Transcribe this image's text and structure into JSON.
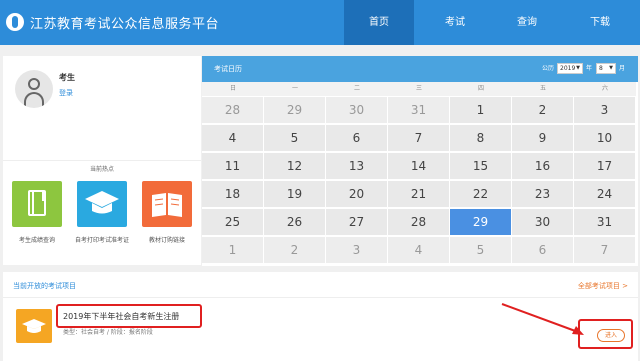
{
  "header": {
    "site_title": "江苏教育考试公众信息服务平台",
    "nav": [
      "首页",
      "考试",
      "查询",
      "下载"
    ],
    "active_nav": "首页"
  },
  "profile": {
    "user_name": "考生",
    "login_link": "登录"
  },
  "hot": {
    "title": "当前热点",
    "tiles": [
      {
        "label": "考生成绩查询",
        "color": "#8dc63f",
        "icon": "notebook-icon"
      },
      {
        "label": "自考打印考试准考证",
        "color": "#2aa9e0",
        "icon": "graduation-cap-icon"
      },
      {
        "label": "教材订购链接",
        "color": "#f26b3a",
        "icon": "open-book-icon"
      }
    ]
  },
  "calendar": {
    "title": "考试日历",
    "year_prefix": "公历",
    "year_value": "2019",
    "year_suffix": "年",
    "month_value": "8",
    "month_suffix": "月",
    "weekdays": [
      "日",
      "一",
      "二",
      "三",
      "四",
      "五",
      "六"
    ],
    "weeks": [
      [
        "28",
        "29",
        "30",
        "31",
        "1",
        "2",
        "3"
      ],
      [
        "4",
        "5",
        "6",
        "7",
        "8",
        "9",
        "10"
      ],
      [
        "11",
        "12",
        "13",
        "14",
        "15",
        "16",
        "17"
      ],
      [
        "18",
        "19",
        "20",
        "21",
        "22",
        "23",
        "24"
      ],
      [
        "25",
        "26",
        "27",
        "28",
        "29",
        "30",
        "31"
      ],
      [
        "1",
        "2",
        "3",
        "4",
        "5",
        "6",
        "7"
      ]
    ],
    "today": "29"
  },
  "projects": {
    "heading": "当前开放的考试项目",
    "all_link": "全部考试项目 >",
    "items": [
      {
        "name": "2019年下半年社会自考新生注册",
        "meta": "类型：社会自考 / 阶段：报名阶段",
        "action": "进入"
      }
    ]
  },
  "colors": {
    "header": "#2d8cd9",
    "active_nav": "#1d6fb8",
    "calendar_bar": "#4aa3df",
    "today": "#4a90e2",
    "highlight": "#e02020",
    "accent": "#e8762c"
  }
}
